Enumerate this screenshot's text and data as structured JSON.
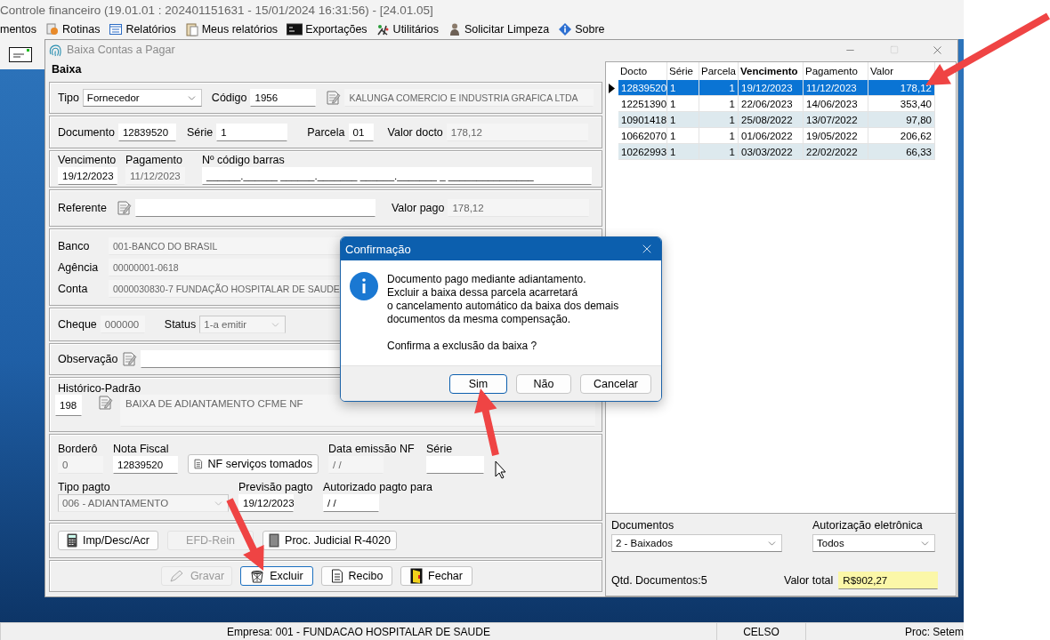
{
  "app": {
    "title": "Controle financeiro (19.01.01 : 202401151631 - 15/01/2024  16:31:56) - [24.01.05]",
    "menu": [
      "mentos",
      "Rotinas",
      "Relatórios",
      "Meus relatórios",
      "Exportações",
      "Utilitários",
      "Solicitar Limpeza",
      "Sobre"
    ]
  },
  "window": {
    "title": "Baixa Contas a Pagar",
    "section": "Baixa"
  },
  "fornecedor": {
    "tipo": {
      "label": "Tipo",
      "value": "Fornecedor",
      "disabled": false
    },
    "codigo": {
      "label": "Código",
      "value": "1956",
      "disabled": false
    },
    "nome": {
      "value": "KALUNGA COMERCIO E INDUSTRIA GRAFICA LTDA",
      "disabled": true
    }
  },
  "documento": {
    "documento": {
      "label": "Documento",
      "value": "12839520",
      "disabled": false
    },
    "serie": {
      "label": "Série",
      "value": "1",
      "disabled": false
    },
    "parcela": {
      "label": "Parcela",
      "value": "01",
      "disabled": false
    },
    "valor_docto": {
      "label": "Valor docto",
      "value": "178,12",
      "disabled": true
    }
  },
  "datas": {
    "vencimento": {
      "label": "Vencimento",
      "value": "19/12/2023",
      "disabled": false
    },
    "pagamento": {
      "label": "Pagamento",
      "value": "11/12/2023",
      "disabled": true
    },
    "codigo_barras": {
      "label": "Nº código barras",
      "value": "______.______ ______._______ ______._______ _ _______________",
      "disabled": false
    }
  },
  "referente": {
    "referente": {
      "label": "Referente",
      "disabled": false
    },
    "valor_pago": {
      "label": "Valor pago",
      "value": "178,12",
      "disabled": true
    }
  },
  "banco": {
    "banco": {
      "label": "Banco",
      "value": "001-BANCO DO BRASIL",
      "disabled": true
    },
    "agencia": {
      "label": "Agência",
      "value": "00000001-0618",
      "disabled": true
    },
    "conta": {
      "label": "Conta",
      "value": "0000030830-7 FUNDAÇÃO HOSPITALAR DE SAUDE",
      "disabled": true
    }
  },
  "cheque": {
    "cheque": {
      "label": "Cheque",
      "value": "000000",
      "disabled": true
    },
    "status": {
      "label": "Status",
      "value": "1-a emitir",
      "disabled": true
    }
  },
  "observacao": {
    "label": "Observação",
    "disabled": false
  },
  "historico": {
    "label": "Histórico-Padrão",
    "codigo": {
      "value": "198",
      "disabled": false
    },
    "texto": {
      "value": "BAIXA DE ADIANTAMENTO CFME NF",
      "disabled": true
    }
  },
  "nota": {
    "bordero": {
      "label": "Borderô",
      "value": "0",
      "disabled": true
    },
    "nota_fiscal": {
      "label": "Nota Fiscal",
      "value": "12839520",
      "disabled": false
    },
    "nf_button": {
      "label": "NF serviços tomados",
      "disabled": false
    },
    "data_emissao": {
      "label": "Data emissão NF",
      "value": " / /",
      "disabled": true
    },
    "serie": {
      "label": "Série",
      "disabled": false
    },
    "tipo_pagto": {
      "label": "Tipo pagto",
      "value": "006 - ADIANTAMENTO",
      "disabled": true
    },
    "previsao": {
      "label": "Previsão pagto",
      "value": "19/12/2023",
      "disabled": false
    },
    "autorizado": {
      "label": "Autorizado pagto para",
      "value": " / /",
      "disabled": false
    }
  },
  "extra_buttons": [
    {
      "label": "Imp/Desc/Acr",
      "disabled": false
    },
    {
      "label": "EFD-Rein",
      "disabled": true
    },
    {
      "label": "Proc. Judicial R-4020",
      "disabled": false
    }
  ],
  "action_buttons": [
    {
      "label": "Gravar",
      "disabled": true,
      "focused": false
    },
    {
      "label": "Excluir",
      "disabled": false,
      "focused": true
    },
    {
      "label": "Recibo",
      "disabled": false,
      "focused": false
    },
    {
      "label": "Fechar",
      "disabled": false,
      "focused": false
    }
  ],
  "grid": {
    "columns": [
      {
        "label": "Docto",
        "sorted": false
      },
      {
        "label": "Série",
        "sorted": false
      },
      {
        "label": "Parcela",
        "sorted": false
      },
      {
        "label": "Vencimento",
        "sorted": true
      },
      {
        "label": "Pagamento",
        "sorted": false
      },
      {
        "label": "Valor",
        "sorted": false
      }
    ],
    "rows": [
      {
        "selected": true,
        "cells": [
          "12839520",
          "1",
          "1",
          "19/12/2023",
          "11/12/2023",
          "178,12"
        ]
      },
      {
        "selected": false,
        "cells": [
          "12251390",
          "1",
          "1",
          "22/06/2023",
          "14/06/2023",
          "353,40"
        ]
      },
      {
        "selected": false,
        "cells": [
          "10901418",
          "1",
          "1",
          "25/08/2022",
          "13/07/2022",
          "97,80"
        ]
      },
      {
        "selected": false,
        "cells": [
          "10662070",
          "1",
          "1",
          "01/06/2022",
          "19/05/2022",
          "206,62"
        ]
      },
      {
        "selected": false,
        "cells": [
          "10262993",
          "1",
          "1",
          "03/03/2022",
          "22/02/2022",
          "66,33"
        ]
      }
    ]
  },
  "filters": {
    "documentos": {
      "label": "Documentos",
      "value": "2 - Baixados"
    },
    "autorizacao": {
      "label": "Autorização eletrônica",
      "value": "Todos"
    },
    "quantidade": "Qtd. Documentos:5",
    "valor_total": {
      "label": "Valor total",
      "value": "R$902,27"
    }
  },
  "dialog": {
    "title": "Confirmação",
    "message": [
      "Documento pago mediante adiantamento.",
      "Excluir a baixa dessa parcela acarretará",
      "o cancelamento automático da baixa dos demais",
      "documentos da mesma compensação."
    ],
    "question": "Confirma a exclusão da baixa ?",
    "buttons": [
      {
        "label": "Sim",
        "focused": true
      },
      {
        "label": "Não",
        "focused": false
      },
      {
        "label": "Cancelar",
        "focused": false
      }
    ]
  },
  "status_bar": [
    "Empresa: 001 - FUNDACAO HOSPITALAR DE SAUDE",
    "CELSO",
    "Proc: Setem"
  ]
}
